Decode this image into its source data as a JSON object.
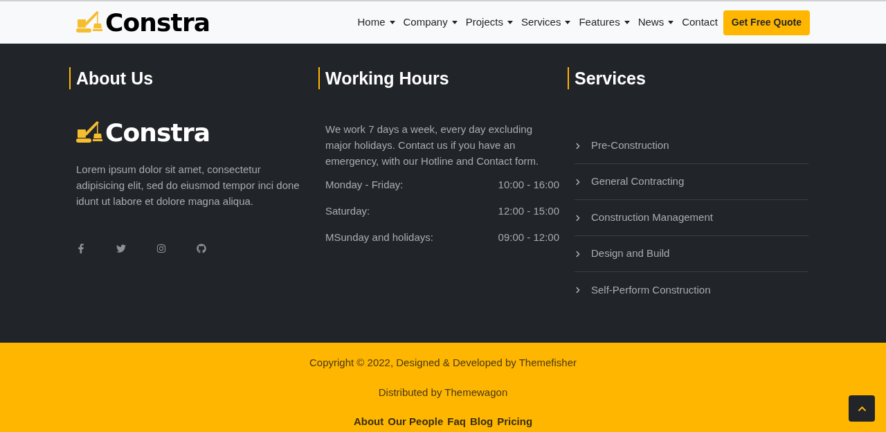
{
  "header": {
    "logo": "Constra",
    "nav": [
      {
        "label": "Home",
        "dropdown": true
      },
      {
        "label": "Company",
        "dropdown": true
      },
      {
        "label": "Projects",
        "dropdown": true
      },
      {
        "label": "Services",
        "dropdown": true
      },
      {
        "label": "Features",
        "dropdown": true
      },
      {
        "label": "News",
        "dropdown": true
      },
      {
        "label": "Contact",
        "dropdown": false
      }
    ],
    "cta": "Get Free Quote"
  },
  "about": {
    "title": "About Us",
    "logo": "Constra",
    "text": "Lorem ipsum dolor sit amet, consectetur adipisicing elit, sed do eiusmod tempor inci done idunt ut labore et dolore magna aliqua.",
    "social": [
      {
        "kind": "facebook"
      },
      {
        "kind": "twitter"
      },
      {
        "kind": "instagram"
      },
      {
        "kind": "github"
      }
    ]
  },
  "hours": {
    "title": "Working Hours",
    "text": "We work 7 days a week, every day excluding major holidays. Contact us if you have an emergency, with our Hotline and Contact form.",
    "rows": [
      {
        "day": "Monday - Friday:",
        "time": "10:00 - 16:00"
      },
      {
        "day": "Saturday:",
        "time": "12:00 - 15:00"
      },
      {
        "day": "MSunday and holidays:",
        "time": "09:00 - 12:00"
      }
    ]
  },
  "services": {
    "title": "Services",
    "items": [
      "Pre-Construction",
      "General Contracting",
      "Construction Management",
      "Design and Build",
      "Self-Perform Construction"
    ]
  },
  "footer": {
    "copyright": "Copyright © 2022, Designed & Developed by Themefisher",
    "distributed": "Distributed by Themewagon",
    "links": [
      "About",
      "Our People",
      "Faq",
      "Blog",
      "Pricing"
    ]
  }
}
